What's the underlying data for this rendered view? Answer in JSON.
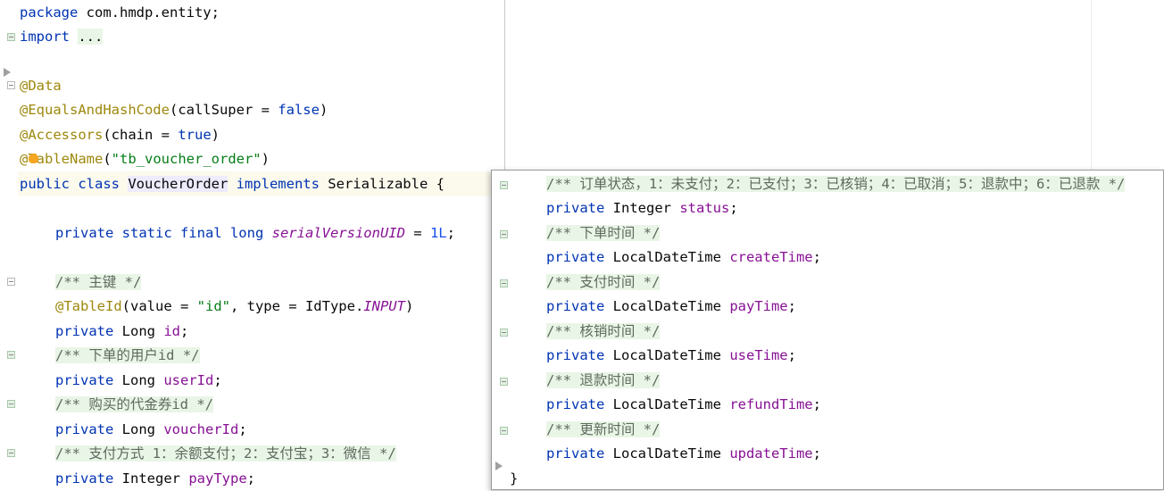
{
  "editor": {
    "package_kw": "package",
    "package_name": " com.hmdp.entity;",
    "import_kw": "import",
    "import_folded": "...",
    "ann_data": "@Data",
    "ann_equals": "@EqualsAndHashCode",
    "equals_args_open": "(callSuper = ",
    "equals_false": "false",
    "equals_close": ")",
    "ann_accessors": "@Accessors",
    "accessors_open": "(chain = ",
    "accessors_true": "true",
    "accessors_close": ")",
    "ann_tablename": "@TableName",
    "tablename_open": "(",
    "tablename_value": "\"tb_voucher_order\"",
    "tablename_close": ")",
    "class_decl_kw": "public class ",
    "class_name": "VoucherOrder",
    "implements_kw": " implements ",
    "class_decl_tail": "Serializable {",
    "serial_kw": "private static final long ",
    "serial_name": "serialVersionUID",
    "serial_eq": " = ",
    "serial_val": "1L",
    "serial_semi": ";",
    "cmt_primary_key": "/** 主键 */",
    "ann_tableid": "@TableId",
    "tableid_open": "(value = ",
    "tableid_value": "\"id\"",
    "tableid_mid": ", type = IdType.",
    "tableid_input": "INPUT",
    "tableid_close": ")",
    "private_kw": "private",
    "type_long": " Long ",
    "type_integer": " Integer ",
    "field_id": "id",
    "semi": ";",
    "cmt_user_id": "/** 下单的用户id */",
    "field_user_id": "userId",
    "cmt_voucher_id": "/** 购买的代金券id */",
    "field_voucher_id": "voucherId",
    "cmt_pay_type": "/** 支付方式 1：余额支付；2：支付宝；3：微信 */",
    "field_pay_type": "payType"
  },
  "popup": {
    "cmt_status": "/** 订单状态，1：未支付；2：已支付；3：已核销；4：已取消；5：退款中；6：已退款 */",
    "private_kw": "private",
    "type_integer": " Integer ",
    "type_ldt": " LocalDateTime ",
    "field_status": "status",
    "semi": ";",
    "cmt_create_time": "/** 下单时间 */",
    "field_create_time": "createTime",
    "cmt_pay_time": "/** 支付时间 */",
    "field_pay_time": "payTime",
    "cmt_use_time": "/** 核销时间 */",
    "field_use_time": "useTime",
    "cmt_refund_time": "/** 退款时间 */",
    "field_refund_time": "refundTime",
    "cmt_update_time": "/** 更新时间 */",
    "field_update_time": "updateTime",
    "closing_brace": "}"
  },
  "colors": {
    "keyword": "#0033b3",
    "annotation": "#9e880d",
    "string": "#067d17",
    "number": "#1750eb",
    "field": "#871094",
    "comment_bg": "#e9f5e6"
  }
}
